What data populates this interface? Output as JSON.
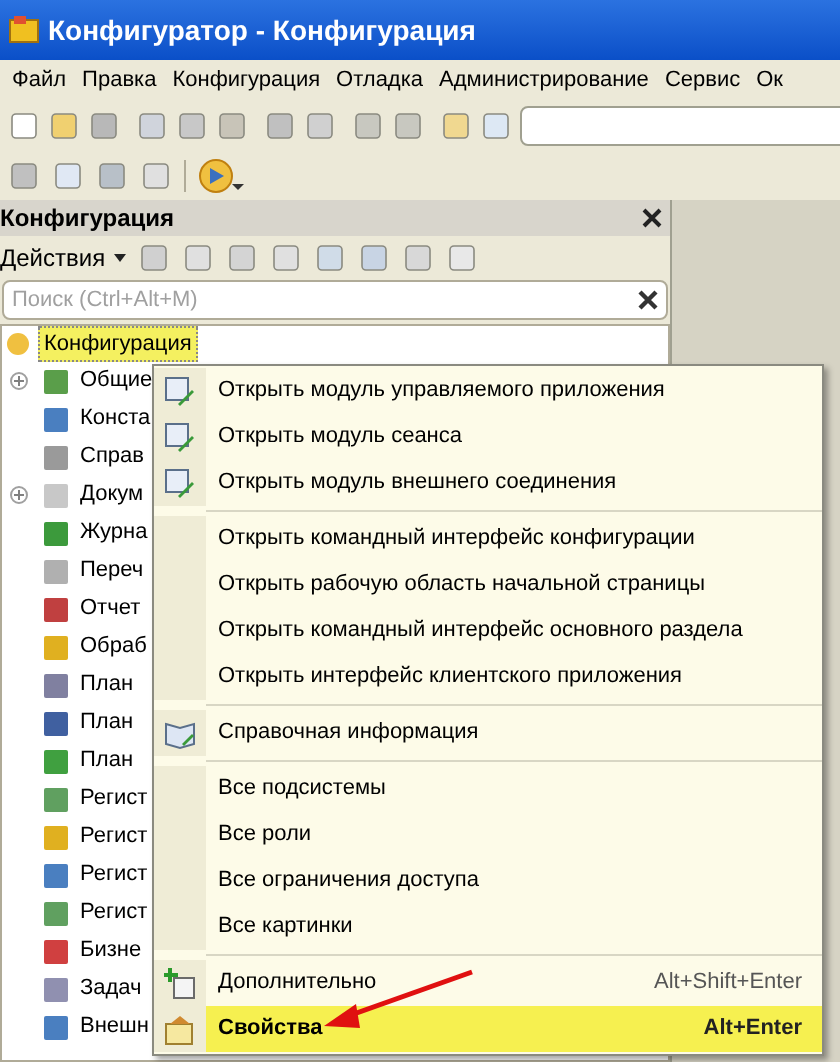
{
  "window": {
    "title": "Конфигуратор - Конфигурация"
  },
  "menu_bar": [
    "Файл",
    "Правка",
    "Конфигурация",
    "Отладка",
    "Администрирование",
    "Сервис",
    "Ок"
  ],
  "panel": {
    "title": "Конфигурация",
    "actions_label": "Действия",
    "search": {
      "placeholder": "Поиск (Ctrl+Alt+M)"
    },
    "tree": {
      "root": {
        "label": "Конфигурация",
        "selected": true
      },
      "items": [
        {
          "label": "Общие",
          "expandable": true
        },
        {
          "label": "Конста",
          "expandable": false
        },
        {
          "label": "Справ",
          "expandable": false
        },
        {
          "label": "Докум",
          "expandable": true
        },
        {
          "label": "Журна",
          "expandable": false
        },
        {
          "label": "Переч",
          "expandable": false
        },
        {
          "label": "Отчет",
          "expandable": false
        },
        {
          "label": "Обраб",
          "expandable": false
        },
        {
          "label": "План",
          "expandable": false
        },
        {
          "label": "План",
          "expandable": false
        },
        {
          "label": "План",
          "expandable": false
        },
        {
          "label": "Регист",
          "expandable": false
        },
        {
          "label": "Регист",
          "expandable": false
        },
        {
          "label": "Регист",
          "expandable": false
        },
        {
          "label": "Регист",
          "expandable": false
        },
        {
          "label": "Бизне",
          "expandable": false
        },
        {
          "label": "Задач",
          "expandable": false
        },
        {
          "label": "Внешн",
          "expandable": false
        }
      ]
    }
  },
  "context_menu": {
    "groups": [
      [
        {
          "label": "Открыть модуль управляемого приложения",
          "kind": "module",
          "selected": false
        },
        {
          "label": "Открыть модуль сеанса",
          "kind": "module",
          "selected": false
        },
        {
          "label": "Открыть модуль внешнего соединения",
          "kind": "module",
          "selected": false
        }
      ],
      [
        {
          "label": "Открыть командный интерфейс конфигурации",
          "kind": "plain",
          "selected": false
        },
        {
          "label": "Открыть рабочую область начальной страницы",
          "kind": "plain",
          "selected": false
        },
        {
          "label": "Открыть командный интерфейс основного раздела",
          "kind": "plain",
          "selected": false
        },
        {
          "label": "Открыть интерфейс клиентского приложения",
          "kind": "plain",
          "selected": false
        }
      ],
      [
        {
          "label": "Справочная информация",
          "kind": "help",
          "selected": false
        }
      ],
      [
        {
          "label": "Все подсистемы",
          "kind": "plain",
          "selected": false
        },
        {
          "label": "Все роли",
          "kind": "plain",
          "selected": false
        },
        {
          "label": "Все ограничения доступа",
          "kind": "plain",
          "selected": false
        },
        {
          "label": "Все картинки",
          "kind": "plain",
          "selected": false
        }
      ],
      [
        {
          "label": "Дополнительно",
          "kind": "extra",
          "shortcut": "Alt+Shift+Enter",
          "selected": false
        },
        {
          "label": "Свойства",
          "kind": "properties",
          "shortcut": "Alt+Enter",
          "selected": true
        }
      ]
    ]
  }
}
